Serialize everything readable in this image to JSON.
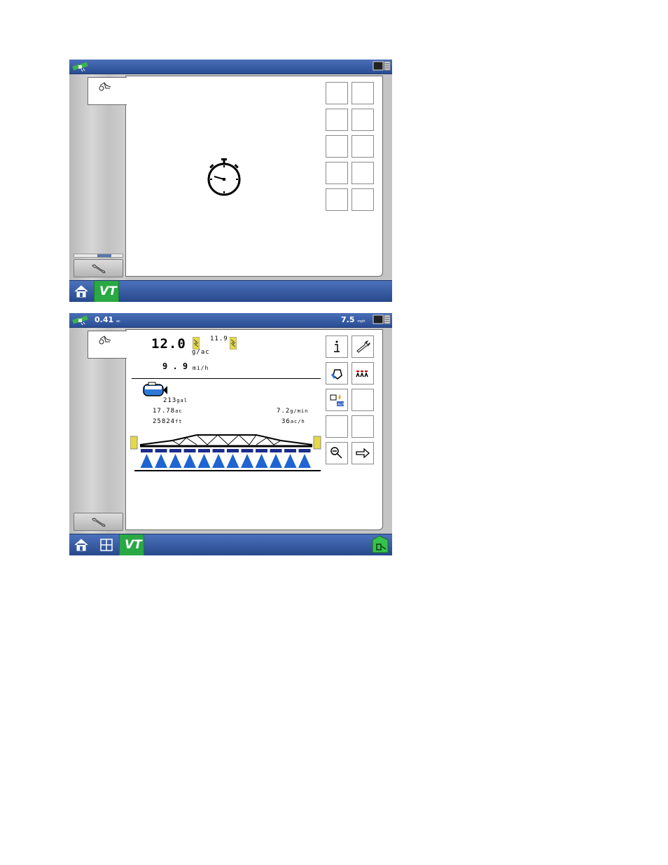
{
  "screen1": {
    "sidebar": {
      "tab_icon": "implement-icon",
      "wrench_icon": "wrench-icon"
    },
    "main": {
      "center_icon": "stopwatch-icon"
    },
    "bottom": {
      "home_icon": "home-icon",
      "vt_label": "VT"
    }
  },
  "screen2": {
    "topbar": {
      "area_value": "0.41",
      "area_unit": "ac",
      "speed_value": "7.5",
      "speed_unit": "mph"
    },
    "main": {
      "rate_target": "12.0",
      "rate_actual": "11.9",
      "rate_unit": "g/ac",
      "speed_value": "9 . 9",
      "speed_unit": "mi/h",
      "tank_volume": "213",
      "tank_unit": "gal",
      "area": "17.78",
      "area_unit": "ac",
      "flow": "7.2",
      "flow_unit": "g/min",
      "distance": "25824",
      "distance_unit": "ft",
      "area_rate": "36",
      "area_rate_unit": "ac/h"
    },
    "buttons": [
      "info-icon",
      "wrench-icon",
      "fill-tank-icon",
      "boom-sections-icon",
      "auto-control-icon",
      "zoom-out-icon",
      "next-arrow-icon"
    ],
    "bottom": {
      "home_icon": "home-icon",
      "split_icon": "split-screen-icon",
      "vt_label": "VT",
      "gps_icon": "gps-status-icon"
    }
  },
  "colors": {
    "bar_blue": "#2a4d94",
    "vt_green": "#2aa844",
    "nozzle_blue": "#1e64d2",
    "section_dark": "#1c2c8c"
  }
}
